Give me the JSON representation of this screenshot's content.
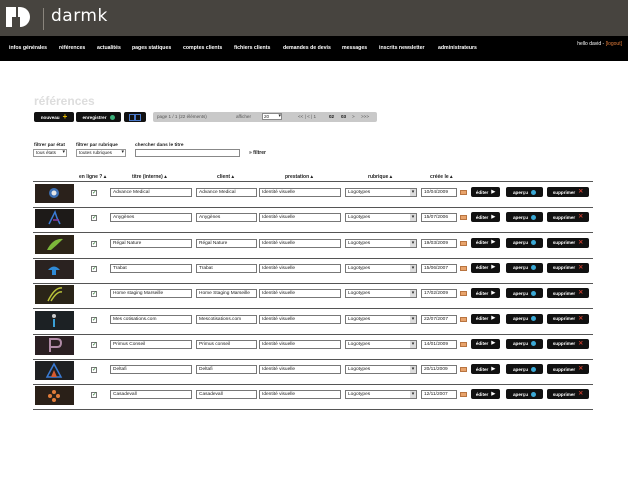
{
  "brand": {
    "name": "darmk"
  },
  "nav": {
    "items": [
      "infos générales",
      "références",
      "actualités",
      "pages statiques",
      "comptes clients",
      "fichiers clients",
      "demandes de devis",
      "messages",
      "inscrits newsletter",
      "administrateurs"
    ],
    "greeting": "hello david -",
    "logout": "[logout]"
  },
  "page": {
    "title": "références"
  },
  "toolbar": {
    "new_label": "nouveau",
    "save_label": "enregistrer"
  },
  "pagination": {
    "summary": "page 1 / 1 (22 éléments)",
    "per_page_label": "afficher",
    "per_page_value": "20",
    "nav_prefix": "<< | < | 1",
    "page2": "02",
    "page3": "03",
    "next": ">",
    "last": ">>>"
  },
  "filters": {
    "state_label": "filtrer par état",
    "state_value": "tous états",
    "rubric_label": "filtrer par rubrique",
    "rubric_value": "toutes rubriques",
    "search_label": "chercher dans le titre",
    "filter_link": "» filtrer"
  },
  "columns": {
    "online": "en ligne ? ▴",
    "title": "titre (interne) ▴",
    "client": "client ▴",
    "prestation": "prestation ▴",
    "rubrique": "rubrique ▴",
    "created": "créée le ▴"
  },
  "actions": {
    "edit": "éditer",
    "preview": "aperçu",
    "delete": "supprimer"
  },
  "rows": [
    {
      "title": "Advance Medical",
      "client": "Advance Medical",
      "prestation": "Identité visuelle",
      "rubrique": "Logotypes",
      "date": "10/04/2009",
      "online": true
    },
    {
      "title": "Anygènes",
      "client": "Anygènes",
      "prestation": "Identité visuelle",
      "rubrique": "Logotypes",
      "date": "15/07/2006",
      "online": true
    },
    {
      "title": "Régal Nature",
      "client": "Régal Nature",
      "prestation": "Identité visuelle",
      "rubrique": "Logotypes",
      "date": "19/03/2009",
      "online": true
    },
    {
      "title": "Trabat",
      "client": "Trabat",
      "prestation": "Identité visuelle",
      "rubrique": "Logotypes",
      "date": "15/06/2007",
      "online": true
    },
    {
      "title": "Home staging Marseille",
      "client": "Home Staging Marseille",
      "prestation": "Identité visuelle",
      "rubrique": "Logotypes",
      "date": "17/02/2009",
      "online": true
    },
    {
      "title": "Mes cotisations.com",
      "client": "Mescotisations.com",
      "prestation": "Identité visuelle",
      "rubrique": "Logotypes",
      "date": "22/07/2007",
      "online": true
    },
    {
      "title": "Primus Conseil",
      "client": "Primus conseil",
      "prestation": "Identité visuelle",
      "rubrique": "Logotypes",
      "date": "14/01/2009",
      "online": true
    },
    {
      "title": "Deltafi",
      "client": "Deltafi",
      "prestation": "Identité visuelle",
      "rubrique": "Logotypes",
      "date": "20/11/2009",
      "online": true
    },
    {
      "title": "Casadevall",
      "client": "Casadevall",
      "prestation": "Identité visuelle",
      "rubrique": "Logotypes",
      "date": "12/11/2007",
      "online": true
    }
  ]
}
